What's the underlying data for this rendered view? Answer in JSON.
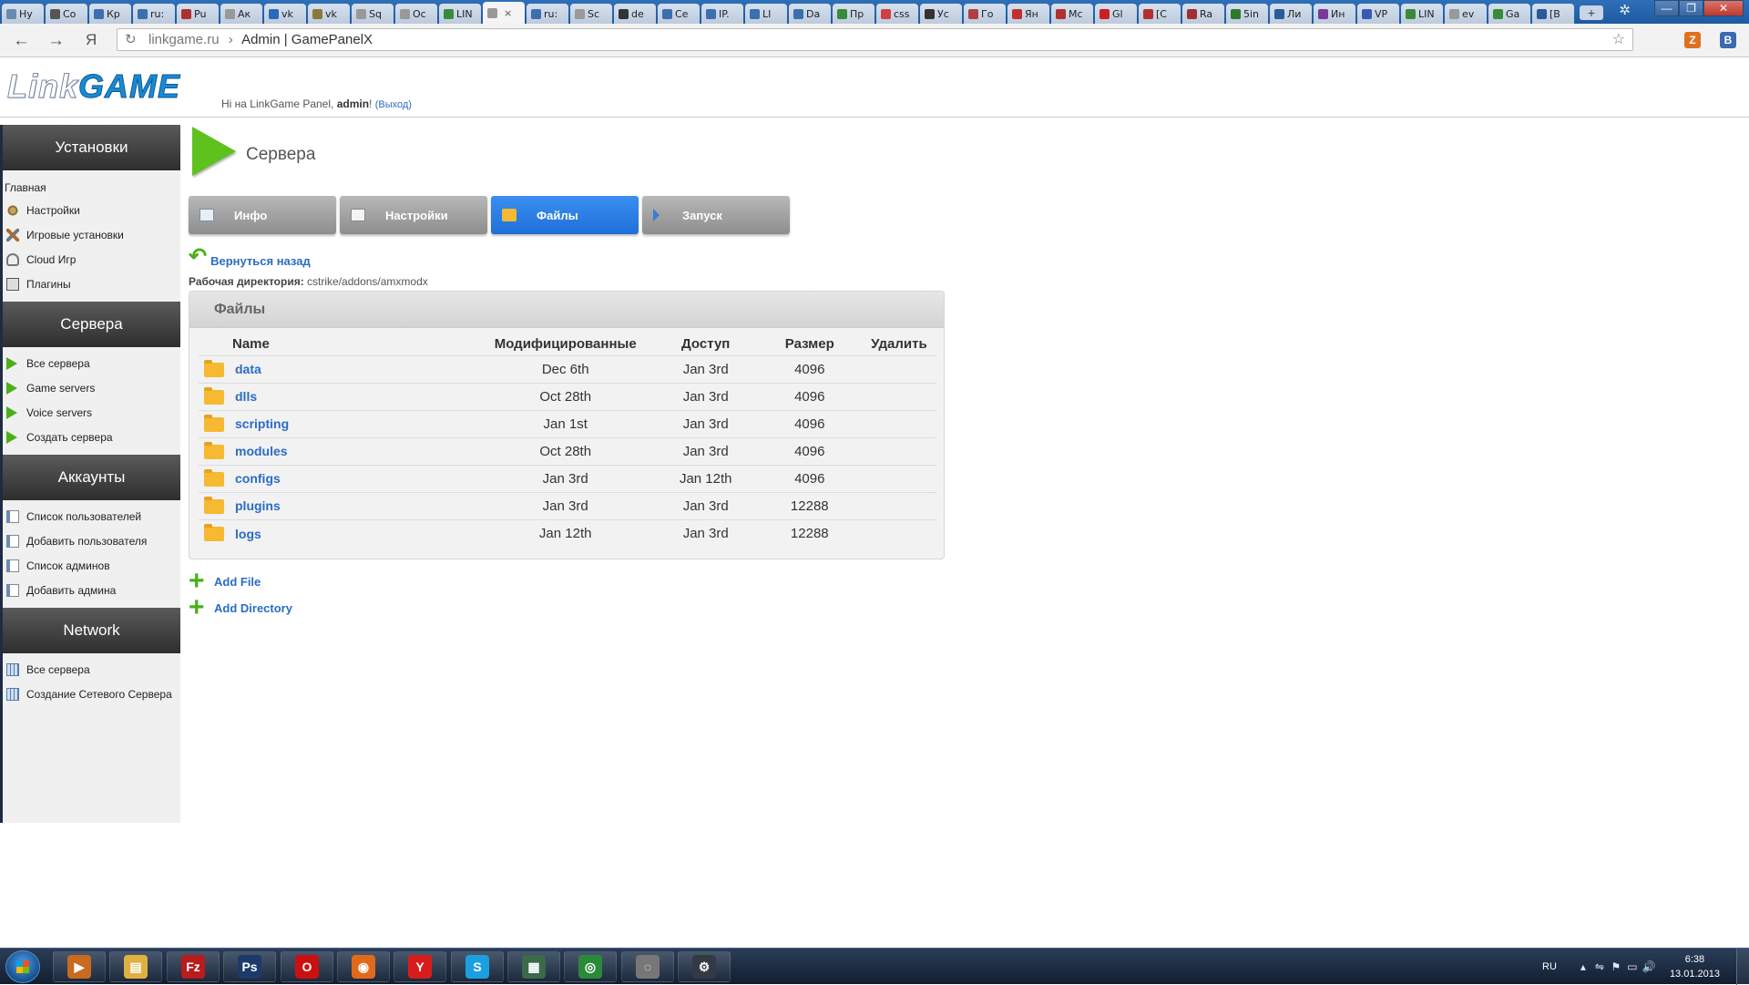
{
  "browser": {
    "tabs": [
      {
        "label": "Ну",
        "color": "#6a8ab0"
      },
      {
        "label": "Co",
        "color": "#555555"
      },
      {
        "label": "Кр",
        "color": "#3b6fb0"
      },
      {
        "label": "ru:",
        "color": "#3b6fb0"
      },
      {
        "label": "Pu",
        "color": "#b03030"
      },
      {
        "label": "Ак",
        "color": "#999999"
      },
      {
        "label": "vk",
        "color": "#2a6ab8"
      },
      {
        "label": "vk",
        "color": "#8a7a3a"
      },
      {
        "label": "Sq",
        "color": "#999999"
      },
      {
        "label": "Ос",
        "color": "#999999"
      },
      {
        "label": "LIN",
        "color": "#3a8a3a"
      },
      {
        "label": "",
        "color": "#999999",
        "active": true
      },
      {
        "label": "ru:",
        "color": "#3b6fb0"
      },
      {
        "label": "Sc",
        "color": "#999999"
      },
      {
        "label": "de",
        "color": "#333333"
      },
      {
        "label": "Се",
        "color": "#3b6fb0"
      },
      {
        "label": "IP.",
        "color": "#3b6fb0"
      },
      {
        "label": "LI",
        "color": "#3b6fb0"
      },
      {
        "label": "Da",
        "color": "#3b6fb0"
      },
      {
        "label": "Пр",
        "color": "#3a8a3a"
      },
      {
        "label": "css",
        "color": "#d04040"
      },
      {
        "label": "Ус",
        "color": "#333333"
      },
      {
        "label": "Го",
        "color": "#b04040"
      },
      {
        "label": "Ян",
        "color": "#c03030"
      },
      {
        "label": "Mc",
        "color": "#b03030"
      },
      {
        "label": "Gl",
        "color": "#cc2020"
      },
      {
        "label": "[C",
        "color": "#b03030"
      },
      {
        "label": "Ra",
        "color": "#a03030"
      },
      {
        "label": "5in",
        "color": "#2a7a2a"
      },
      {
        "label": "Ли",
        "color": "#2a5a9a"
      },
      {
        "label": "Ин",
        "color": "#7a3a9a"
      },
      {
        "label": "VP",
        "color": "#3a5ab0"
      },
      {
        "label": "LIN",
        "color": "#3a8a3a"
      },
      {
        "label": "ev",
        "color": "#999999"
      },
      {
        "label": "Ga",
        "color": "#3a8a3a"
      },
      {
        "label": "[B",
        "color": "#2a5a9a"
      }
    ],
    "active_tab_close": "×",
    "new_tab": "+",
    "back_icon": "←",
    "forward_icon": "→",
    "yandex_icon": "Я",
    "reload_icon": "↻",
    "url_host": "linkgame.ru",
    "url_sep": "›",
    "url_title": "Admin | GamePanelX",
    "star_icon": "☆",
    "ext1": "Z",
    "ext1_color": "#e07020",
    "ext2": "B",
    "ext2_color": "#3a6ab0",
    "window_controls": [
      "—",
      "❐",
      "✕"
    ],
    "gear_icon": "✲"
  },
  "header": {
    "logo_part1": "Link",
    "logo_part2": "GAME",
    "greeting_prefix": "Hi на LinkGame Panel, ",
    "user": "admin",
    "greeting_suffix": "! ",
    "logout": "(Выход)"
  },
  "sidebar": {
    "sections": [
      {
        "title": "Установки",
        "home": "Главная",
        "items": [
          {
            "label": "Настройки",
            "icon": "gear"
          },
          {
            "label": "Игровые установки",
            "icon": "tools"
          },
          {
            "label": "Cloud Игр",
            "icon": "cloud"
          },
          {
            "label": "Плагины",
            "icon": "plug"
          }
        ]
      },
      {
        "title": "Сервера",
        "items": [
          {
            "label": "Все сервера",
            "icon": "play"
          },
          {
            "label": "Game servers",
            "icon": "play"
          },
          {
            "label": "Voice servers",
            "icon": "play"
          },
          {
            "label": "Создать сервера",
            "icon": "play"
          }
        ]
      },
      {
        "title": "Аккаунты",
        "items": [
          {
            "label": "Список пользователей",
            "icon": "doc"
          },
          {
            "label": "Добавить пользователя",
            "icon": "doc"
          },
          {
            "label": "Список админов",
            "icon": "doc"
          },
          {
            "label": "Добавить админа",
            "icon": "doc"
          }
        ]
      },
      {
        "title": "Network",
        "items": [
          {
            "label": "Все сервера",
            "icon": "net"
          },
          {
            "label": "Создание Сетевого Сервера",
            "icon": "net"
          }
        ]
      }
    ]
  },
  "content": {
    "title": "Сервера",
    "tabs": [
      {
        "label": "Инфо",
        "icon": "info"
      },
      {
        "label": "Настройки",
        "icon": "settings"
      },
      {
        "label": "Файлы",
        "icon": "folder",
        "active": true
      },
      {
        "label": "Запуск",
        "icon": "arrow"
      }
    ],
    "back_icon": "↶",
    "back_label": "Вернуться назад",
    "workdir_label": "Рабочая директория:",
    "workdir_value": "cstrike/addons/amxmodx",
    "panel_title": "Файлы",
    "columns": [
      "Name",
      "Модифицированные",
      "Доступ",
      "Размер",
      "Удалить"
    ],
    "files": [
      {
        "name": "data",
        "modified": "Dec 6th",
        "access": "Jan 3rd",
        "size": "4096"
      },
      {
        "name": "dlls",
        "modified": "Oct 28th",
        "access": "Jan 3rd",
        "size": "4096"
      },
      {
        "name": "scripting",
        "modified": "Jan 1st",
        "access": "Jan 3rd",
        "size": "4096"
      },
      {
        "name": "modules",
        "modified": "Oct 28th",
        "access": "Jan 3rd",
        "size": "4096"
      },
      {
        "name": "configs",
        "modified": "Jan 3rd",
        "access": "Jan 12th",
        "size": "4096"
      },
      {
        "name": "plugins",
        "modified": "Jan 3rd",
        "access": "Jan 3rd",
        "size": "12288"
      },
      {
        "name": "logs",
        "modified": "Jan 12th",
        "access": "Jan 3rd",
        "size": "12288"
      }
    ],
    "plus_icon": "+",
    "add_file": "Add File",
    "add_directory": "Add Directory"
  },
  "taskbar": {
    "apps": [
      {
        "name": "media-player",
        "glyph": "▶",
        "bg": "#c86a20"
      },
      {
        "name": "explorer",
        "glyph": "▤",
        "bg": "#e0b040"
      },
      {
        "name": "filezilla",
        "glyph": "Fz",
        "bg": "#b81c1c"
      },
      {
        "name": "photoshop",
        "glyph": "Ps",
        "bg": "#1c3a6a"
      },
      {
        "name": "opera",
        "glyph": "O",
        "bg": "#cc1010"
      },
      {
        "name": "firefox",
        "glyph": "◉",
        "bg": "#e06a1a"
      },
      {
        "name": "yandex-browser",
        "glyph": "Y",
        "bg": "#d81c1c"
      },
      {
        "name": "skype",
        "glyph": "S",
        "bg": "#1aa0e0"
      },
      {
        "name": "network-tool",
        "glyph": "▦",
        "bg": "#3a6a4a"
      },
      {
        "name": "chrome",
        "glyph": "◎",
        "bg": "#2a8a3a"
      },
      {
        "name": "disc-tool",
        "glyph": "◌",
        "bg": "#777777"
      },
      {
        "name": "steam",
        "glyph": "⚙",
        "bg": "#333a44"
      }
    ],
    "lang": "RU",
    "tray_icons": [
      "▴",
      "⇋",
      "⚑",
      "▭",
      "🔊"
    ],
    "time": "6:38",
    "date": "13.01.2013"
  }
}
